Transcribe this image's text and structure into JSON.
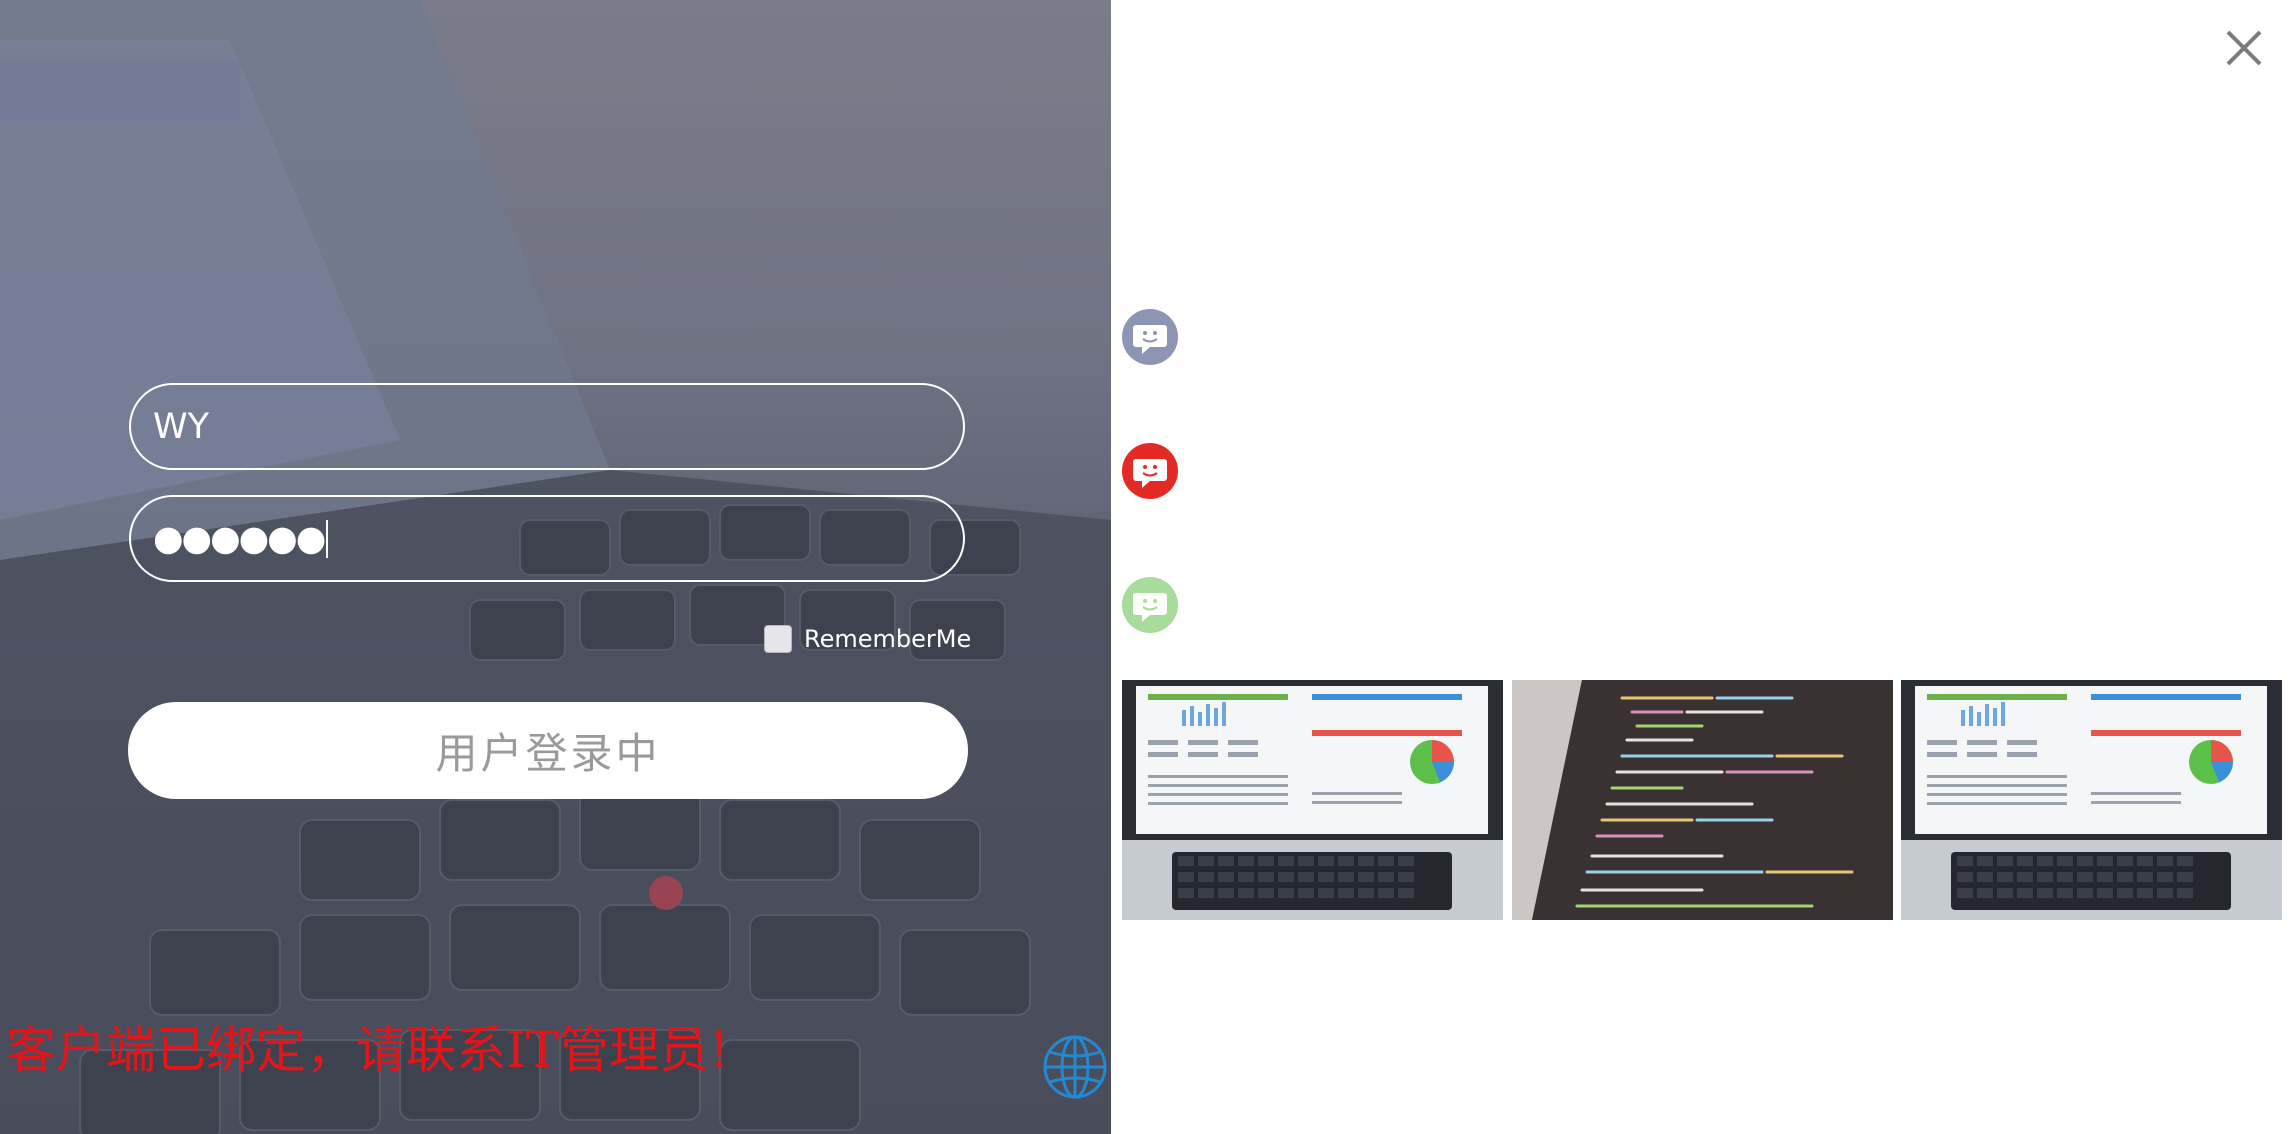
{
  "login": {
    "username_value": "WY",
    "password_value": "●●●●●●",
    "remember_label": "RememberMe",
    "remember_checked": false,
    "login_button_label": "用户登录中",
    "error_message": "客户端已绑定，请联系IT管理员!",
    "error_color": "#e0161b"
  },
  "icons": {
    "close": "close-icon",
    "language": "globe-icon",
    "chat_1": "chat-bubble-icon",
    "chat_2": "chat-bubble-icon",
    "chat_3": "chat-bubble-icon"
  },
  "colors": {
    "chat_1": "#8c96b4",
    "chat_2": "#e32a25",
    "chat_3": "#a7dc9a",
    "globe": "#2389d0"
  },
  "thumbnails": [
    {
      "name": "laptop-dashboard-thumbnail"
    },
    {
      "name": "code-screen-thumbnail"
    },
    {
      "name": "laptop-dashboard-thumbnail"
    }
  ]
}
